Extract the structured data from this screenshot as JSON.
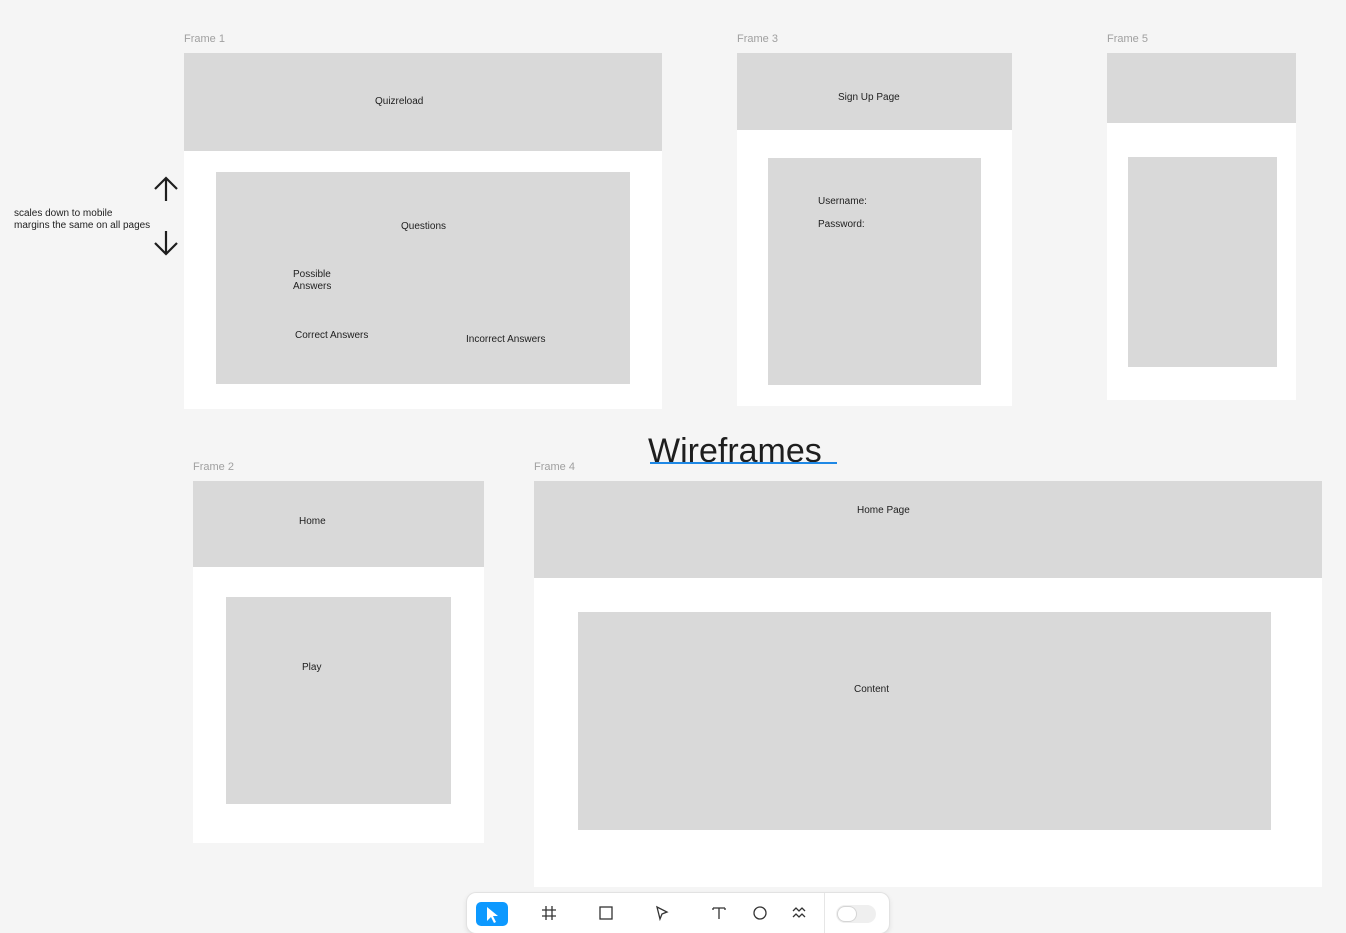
{
  "page_title": "Wireframes",
  "note": {
    "line1": "scales down to mobile",
    "line2": "margins the same on all pages"
  },
  "frames": {
    "frame1": {
      "label": "Frame 1",
      "header": "Quizreload",
      "questions": "Questions",
      "possible_line1": "Possible",
      "possible_line2": "Answers",
      "correct": "Correct Answers",
      "incorrect": "Incorrect Answers"
    },
    "frame3": {
      "label": "Frame 3",
      "header": "Sign Up Page",
      "username": "Username:",
      "password": "Password:"
    },
    "frame5": {
      "label": "Frame 5"
    },
    "frame2": {
      "label": "Frame 2",
      "header": "Home",
      "play": "Play"
    },
    "frame4": {
      "label": "Frame 4",
      "header": "Home Page",
      "content": "Content"
    }
  },
  "colors": {
    "canvas": "#f5f5f5",
    "block": "#d9d9d9",
    "accent": "#0d99ff"
  },
  "toolbar": {
    "tools": [
      "move-tool-icon",
      "frame-tool-icon",
      "rectangle-tool-icon",
      "pen-tool-icon",
      "text-tool-icon",
      "comment-tool-icon",
      "actions-tool-icon",
      "dev-mode-toggle"
    ]
  }
}
